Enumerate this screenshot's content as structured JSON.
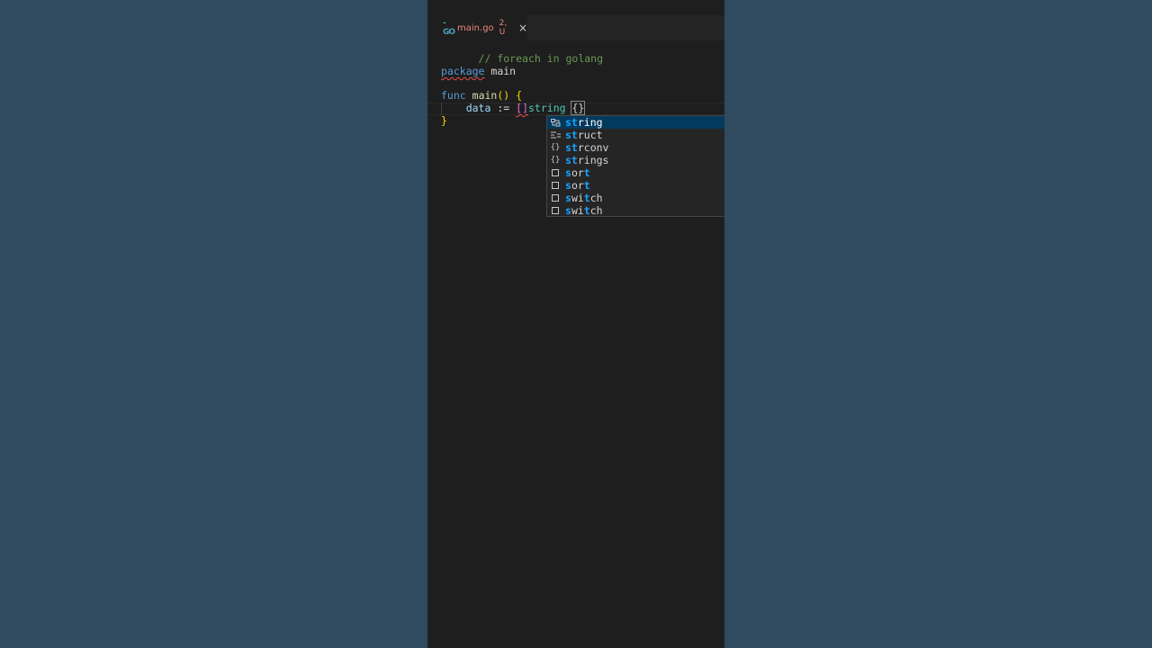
{
  "tab": {
    "icon": "go-icon",
    "filename": "main.go",
    "badge": "2, U",
    "close": "×"
  },
  "code": {
    "line1": "// foreach in golang",
    "package_kw": "package",
    "package_name": "main",
    "func_kw": "func",
    "func_name": "main",
    "func_parens": "()",
    "open_brace": "{",
    "var": "data",
    "assign": ":=",
    "slice": "[]",
    "type": "string",
    "cursor_brace": "{}",
    "close_brace": "}"
  },
  "suggestions": [
    {
      "icon": "snippet-icon",
      "match": "st",
      "rest": "ring",
      "selected": true
    },
    {
      "icon": "struct-snippet-icon",
      "match": "st",
      "rest": "ruct",
      "selected": false
    },
    {
      "icon": "module-icon",
      "match": "st",
      "rest": "rconv",
      "selected": false
    },
    {
      "icon": "module-icon",
      "match": "st",
      "rest": "rings",
      "selected": false
    },
    {
      "icon": "keyword-icon",
      "match": "s",
      "mid": "or",
      "end": "t",
      "selected": false
    },
    {
      "icon": "keyword-icon",
      "match": "s",
      "mid": "or",
      "end": "t",
      "selected": false
    },
    {
      "icon": "keyword-icon",
      "match": "s",
      "mid": "wi",
      "end": "t",
      "tail": "ch",
      "selected": false
    },
    {
      "icon": "keyword-icon",
      "match": "s",
      "mid": "wi",
      "end": "t",
      "tail": "ch",
      "selected": false
    }
  ],
  "colors": {
    "background": "#304b60",
    "editor": "#1e1e1e",
    "selection": "#04395e"
  }
}
